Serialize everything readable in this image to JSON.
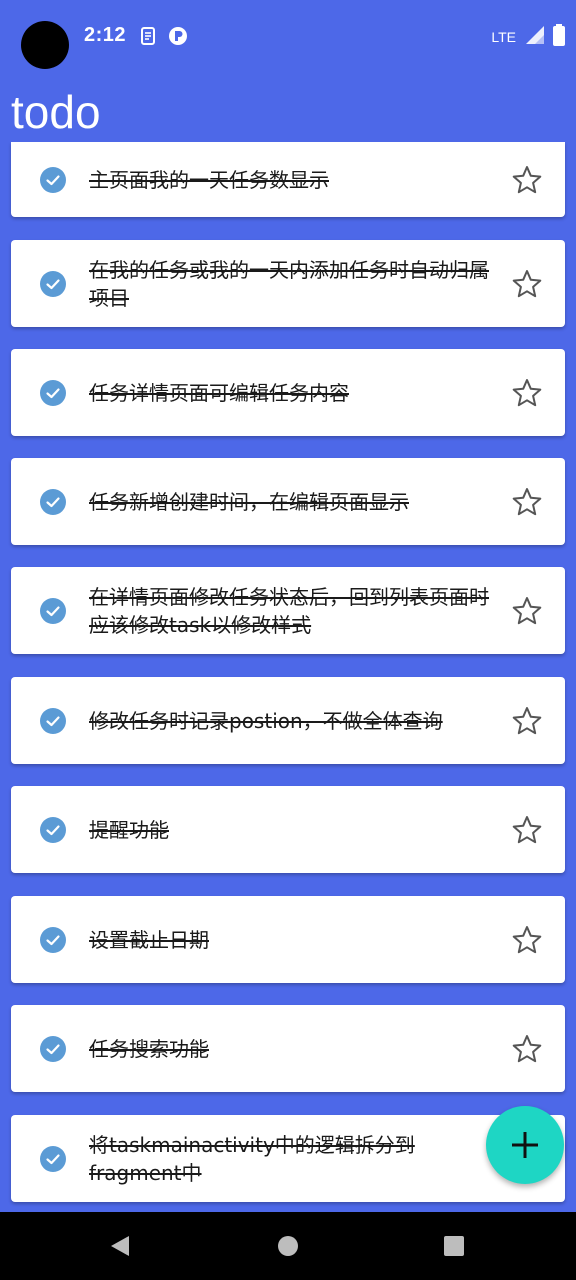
{
  "status_bar": {
    "time": "2:12",
    "network": "LTE",
    "icons": [
      "document-icon",
      "app-r-icon",
      "signal-icon",
      "battery-icon"
    ]
  },
  "app_bar": {
    "title": "todo"
  },
  "tasks": [
    {
      "text": "主页面我的一天任务数显示",
      "completed": true,
      "starred": false
    },
    {
      "text": "在我的任务或我的一天内添加任务时自动归属项目",
      "completed": true,
      "starred": false
    },
    {
      "text": "任务详情页面可编辑任务内容",
      "completed": true,
      "starred": false
    },
    {
      "text": "任务新增创建时间，在编辑页面显示",
      "completed": true,
      "starred": false
    },
    {
      "text": "在详情页面修改任务状态后，回到列表页面时应该修改task以修改样式",
      "completed": true,
      "starred": false
    },
    {
      "text": "修改任务时记录postion，不做全体查询",
      "completed": true,
      "starred": false
    },
    {
      "text": "提醒功能",
      "completed": true,
      "starred": false
    },
    {
      "text": "设置截止日期",
      "completed": true,
      "starred": false
    },
    {
      "text": "任务搜索功能",
      "completed": true,
      "starred": false
    },
    {
      "text": "将taskmainactivity中的逻辑拆分到fragment中",
      "completed": true,
      "starred": false
    }
  ],
  "fab": {
    "icon": "plus-icon"
  },
  "nav_bar": {
    "buttons": [
      "back-icon",
      "home-icon",
      "recents-icon"
    ]
  },
  "colors": {
    "primary": "#4d68e8",
    "accent": "#1ed6c4",
    "check": "#5b9bd5",
    "card": "#ffffff"
  }
}
